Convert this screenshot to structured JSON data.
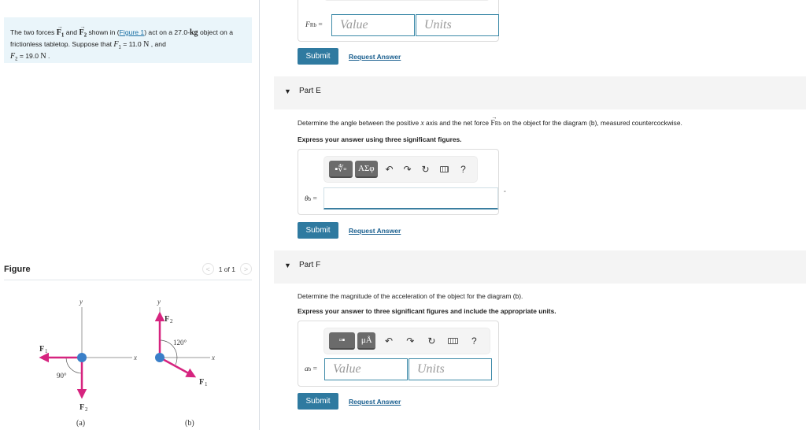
{
  "problem": {
    "text_1": "The two forces ",
    "f1_symbol": "F",
    "f1_sub": "1",
    "and": " and ",
    "f2_symbol": "F",
    "f2_sub": "2",
    "text_2": " shown in (",
    "figure_link": "Figure 1",
    "text_3": ") act on a 27.0-",
    "kg": "kg",
    "text_4": " object on a frictionless tabletop. Suppose that ",
    "F1_label": "F",
    "F1_sub": "1",
    "F1_value": " = 11.0 ",
    "unit_N": "N",
    "text_5": " , and",
    "F2_label": "F",
    "F2_sub": "2",
    "F2_value": " = 19.0 ",
    "end": " ."
  },
  "figure_panel": {
    "title": "Figure",
    "pager_text": "1 of 1",
    "prev_icon": "<",
    "next_icon": ">"
  },
  "figure": {
    "a": {
      "caption": "(a)",
      "y_label": "y",
      "x_label": "x",
      "f1_label": "F",
      "f1_sub": "1",
      "f2_label": "F",
      "f2_sub": "2",
      "angle_label": "90°"
    },
    "b": {
      "caption": "(b)",
      "y_label": "y",
      "x_label": "x",
      "f1_label": "F",
      "f1_sub": "1",
      "f2_label": "F",
      "f2_sub": "2",
      "angle_label": "120°"
    },
    "colors": {
      "force": "#d6247f",
      "object": "#3a7fc8",
      "axis": "#9a9a9a"
    }
  },
  "part_d_tail": {
    "label": "F",
    "label_sub": "Rb",
    "equals": "=",
    "value_placeholder": "Value",
    "units_placeholder": "Units",
    "submit": "Submit",
    "request": "Request Answer"
  },
  "part_e": {
    "title": "Part E",
    "question_1": "Determine the angle between the positive ",
    "question_x": "x",
    "question_2": " axis and the net force ",
    "question_F": "F",
    "question_F_sub": "Rb",
    "question_3": " on the object for the diagram (b), measured countercockwise.",
    "instruction": "Express your answer using three significant figures.",
    "toolbar": {
      "template_btn": "▪∜▫",
      "greek_btn": "ΑΣφ",
      "undo": "↶",
      "redo": "↷",
      "reset": "↻",
      "help": "?"
    },
    "label": "θ",
    "label_sub": "b",
    "equals": "=",
    "input_value": "",
    "unit_suffix": "°",
    "submit": "Submit",
    "request": "Request Answer"
  },
  "part_f": {
    "title": "Part F",
    "question": "Determine the magnitude of the acceleration of the object for the diagram (b).",
    "instruction": "Express your answer to three significant figures and include the appropriate units.",
    "toolbar": {
      "template_btn": "▫▪",
      "units_btn": "μÅ",
      "undo": "↶",
      "redo": "↷",
      "reset": "↻",
      "help": "?"
    },
    "label": "a",
    "label_sub": "b",
    "equals": "=",
    "value_placeholder": "Value",
    "units_placeholder": "Units",
    "submit": "Submit",
    "request": "Request Answer"
  }
}
